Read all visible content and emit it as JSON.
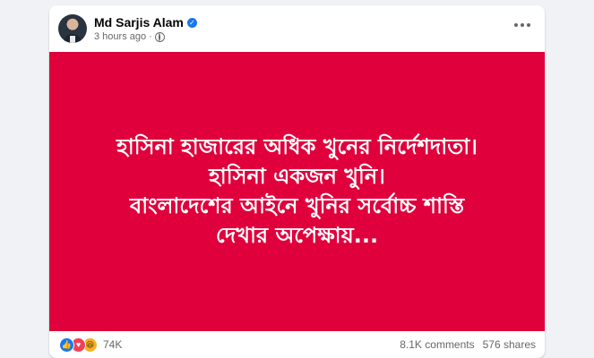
{
  "post": {
    "author": "Md Sarjis Alam",
    "timestamp": "3 hours ago",
    "separator": "·",
    "verified_icon": "verified-badge-icon",
    "audience_icon": "globe-icon",
    "menu_icon": "more-horizontal-icon",
    "image": {
      "background_color": "#e0003c",
      "lines": [
        "হাসিনা হাজারের অধিক খুনের নির্দেশদাতা।",
        "হাসিনা একজন খুনি।",
        "বাংলাদেশের আইনে খুনির সর্বোচ্চ শাস্তি",
        "দেখার অপেক্ষায়..."
      ]
    },
    "reactions": {
      "icons": [
        "like-icon",
        "love-icon",
        "haha-icon"
      ],
      "count": "74K"
    },
    "comments": "8.1K comments",
    "shares": "576 shares"
  },
  "colors": {
    "accent": "#1877f2",
    "secondary_text": "#65676b"
  }
}
